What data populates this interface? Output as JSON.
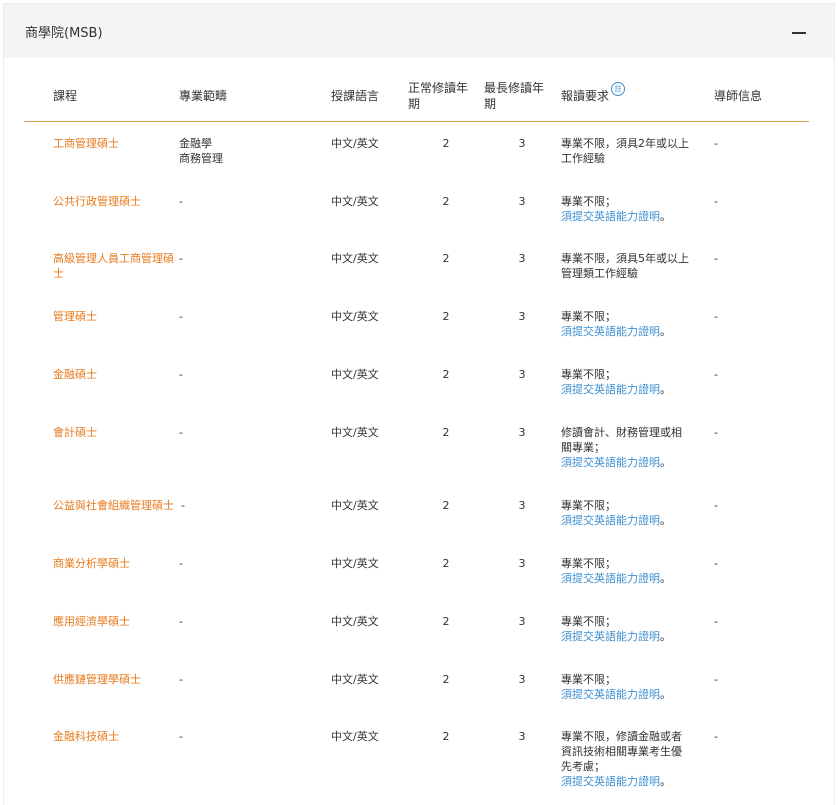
{
  "panel": {
    "title": "商學院(MSB)",
    "collapse_symbol": "—"
  },
  "table": {
    "headers": {
      "program": "課程",
      "field": "專業範疇",
      "language": "授課語言",
      "normal_years_1": "正常修讀年",
      "normal_years_2": "期",
      "max_years_1": "最長修讀年",
      "max_years_2": "期",
      "requirement": "報讀要求",
      "requirement_note": "註",
      "tutor": "導師信息"
    },
    "rows": [
      {
        "name": "工商管理碩士",
        "field_1": "金融學",
        "field_2": "商務管理",
        "language": "中文/英文",
        "normal": "2",
        "max": "3",
        "req_1": "專業不限，須具2年或以上",
        "req_2": "工作經驗",
        "req_link": "",
        "tutor": "-"
      },
      {
        "name": "公共行政管理碩士",
        "field_1": "-",
        "field_2": "",
        "language": "中文/英文",
        "normal": "2",
        "max": "3",
        "req_1": "專業不限；",
        "req_2": "",
        "req_link": "須提交英語能力證明",
        "tutor": "-"
      },
      {
        "name_1": "高級管理人員工商管理碩",
        "name_2": "士",
        "field_1": "-",
        "language": "中文/英文",
        "normal": "2",
        "max": "3",
        "req_1": "專業不限，須具5年或以上",
        "req_2": "管理類工作經驗",
        "req_link": "",
        "tutor": "-"
      },
      {
        "name": "管理碩士",
        "field_1": "-",
        "language": "中文/英文",
        "normal": "2",
        "max": "3",
        "req_1": "專業不限；",
        "req_link": "須提交英語能力證明",
        "tutor": "-"
      },
      {
        "name": "金融碩士",
        "field_1": "-",
        "language": "中文/英文",
        "normal": "2",
        "max": "3",
        "req_1": "專業不限；",
        "req_link": "須提交英語能力證明",
        "tutor": "-"
      },
      {
        "name": "會計碩士",
        "field_1": "-",
        "language": "中文/英文",
        "normal": "2",
        "max": "3",
        "req_1": "修讀會計、財務管理或相",
        "req_2": "關專業；",
        "req_link": "須提交英語能力證明",
        "tutor": "-"
      },
      {
        "name": "公益與社會組織管理碩士",
        "field_1": "-",
        "language": "中文/英文",
        "normal": "2",
        "max": "3",
        "req_1": "專業不限；",
        "req_link": "須提交英語能力證明",
        "tutor": "-"
      },
      {
        "name": "商業分析學碩士",
        "field_1": "-",
        "language": "中文/英文",
        "normal": "2",
        "max": "3",
        "req_1": "專業不限；",
        "req_link": "須提交英語能力證明",
        "tutor": "-"
      },
      {
        "name": "應用經濟學碩士",
        "field_1": "-",
        "language": "中文/英文",
        "normal": "2",
        "max": "3",
        "req_1": "專業不限；",
        "req_link": "須提交英語能力證明",
        "tutor": "-"
      },
      {
        "name": "供應鏈管理學碩士",
        "field_1": "-",
        "language": "中文/英文",
        "normal": "2",
        "max": "3",
        "req_1": "專業不限；",
        "req_link": "須提交英語能力證明",
        "tutor": "-"
      },
      {
        "name": "金融科技碩士",
        "field_1": "-",
        "language": "中文/英文",
        "normal": "2",
        "max": "3",
        "req_1": "專業不限，修讀金融或者",
        "req_2": "資訊技術相關專業考生優",
        "req_3": "先考慮；",
        "req_link": "須提交英語能力證明",
        "tutor": "-"
      }
    ],
    "link_period": "。"
  },
  "colors": {
    "program_link": "#e97a1d",
    "requirement_link": "#3d8fd1",
    "header_divider": "#e0a252",
    "panel_header_bg": "#f5f5f5"
  }
}
